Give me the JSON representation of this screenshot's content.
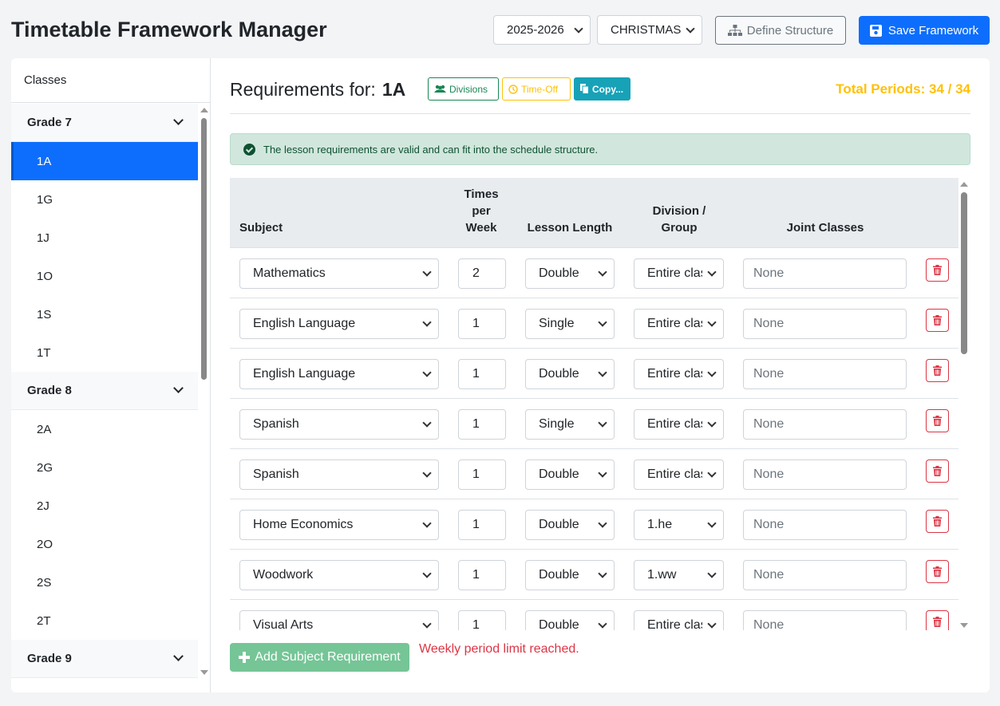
{
  "app": {
    "title": "Timetable Framework Manager",
    "year_select": "2025-2026",
    "term_select": "CHRISTMAS",
    "define_label": "Define Structure",
    "save_label": "Save Framework"
  },
  "sidebar": {
    "header": "Classes",
    "groups": [
      {
        "grade": "Grade 7",
        "classes": [
          "1A",
          "1G",
          "1J",
          "1O",
          "1S",
          "1T"
        ]
      },
      {
        "grade": "Grade 8",
        "classes": [
          "2A",
          "2G",
          "2J",
          "2O",
          "2S",
          "2T"
        ]
      },
      {
        "grade": "Grade 9",
        "classes": []
      }
    ],
    "active_class": "1A"
  },
  "main": {
    "title_prefix": "Requirements for:",
    "title_class": "1A",
    "divisions_label": "Divisions",
    "timeoff_label": "Time-Off",
    "copy_label": "Copy...",
    "total_periods": "Total Periods: 34 / 34",
    "alert": "The lesson requirements are valid and can fit into the schedule structure.",
    "columns": {
      "subject": "Subject",
      "times_l1": "Times",
      "times_l2": "per",
      "times_l3": "Week",
      "length": "Lesson Length",
      "division_l1": "Division /",
      "division_l2": "Group",
      "joint": "Joint Classes"
    },
    "rows": [
      {
        "subject": "Mathematics",
        "times": "2",
        "length": "Double",
        "division": "Entire class",
        "joint": "None"
      },
      {
        "subject": "English Language",
        "times": "1",
        "length": "Single",
        "division": "Entire class",
        "joint": "None"
      },
      {
        "subject": "English Language",
        "times": "1",
        "length": "Double",
        "division": "Entire class",
        "joint": "None"
      },
      {
        "subject": "Spanish",
        "times": "1",
        "length": "Single",
        "division": "Entire class",
        "joint": "None"
      },
      {
        "subject": "Spanish",
        "times": "1",
        "length": "Double",
        "division": "Entire class",
        "joint": "None"
      },
      {
        "subject": "Home Economics",
        "times": "1",
        "length": "Double",
        "division": "1.he",
        "joint": "None"
      },
      {
        "subject": "Woodwork",
        "times": "1",
        "length": "Double",
        "division": "1.ww",
        "joint": "None"
      },
      {
        "subject": "Visual Arts",
        "times": "1",
        "length": "Double",
        "division": "Entire class",
        "joint": "None"
      }
    ],
    "add_label": "Add Subject Requirement",
    "limit_message": "Weekly period limit reached."
  },
  "colors": {
    "primary": "#0d6efd",
    "success": "#198754",
    "warning": "#ffc107",
    "info": "#17a2b8",
    "danger": "#dc3545",
    "alert_bg": "#d1e7dd"
  }
}
